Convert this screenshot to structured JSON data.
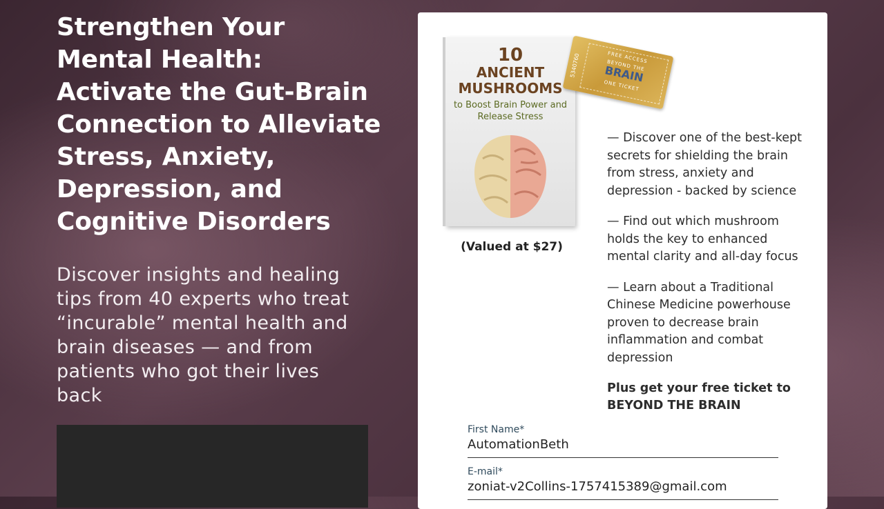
{
  "hero": {
    "headline": "Strengthen Your Mental Health: Activate the Gut-Brain Connection to Alleviate Stress, Anxiety, Depression, and Cognitive Disorders",
    "subhead": "Discover insights and healing tips from 40 experts who treat “incurable” mental health and brain diseases — and from patients who got their lives back"
  },
  "offer": {
    "book": {
      "number": "10",
      "title": "ANCIENT MUSHROOMS",
      "subtitle": "to Boost Brain Power and Release Stress"
    },
    "ticket": {
      "top": "FREE ACCESS",
      "event_small": "BEYOND THE",
      "event_big": "BRAIN",
      "bottom": "ONE TICKET",
      "serial": "5340760"
    },
    "valued": "(Valued at $27)",
    "bullets": [
      "— Discover one of the best-kept secrets for shielding the brain from stress, anxiety and depression - backed by science",
      "— Find out which mushroom holds the key to enhanced mental clarity and all-day focus",
      "— Learn about a Traditional Chinese Medicine powerhouse proven to decrease brain inflammation and combat depression"
    ],
    "plus": "Plus get your free ticket to BEYOND THE BRAIN"
  },
  "form": {
    "first_name": {
      "label": "First Name*",
      "value": "AutomationBeth"
    },
    "email": {
      "label": "E-mail*",
      "value": "zoniat-v2Collins-1757415389@gmail.com"
    }
  },
  "colors": {
    "background": "#4b313e",
    "card": "#ffffff",
    "book_title": "#6b4321",
    "ticket_gold": "#c99a3a"
  }
}
